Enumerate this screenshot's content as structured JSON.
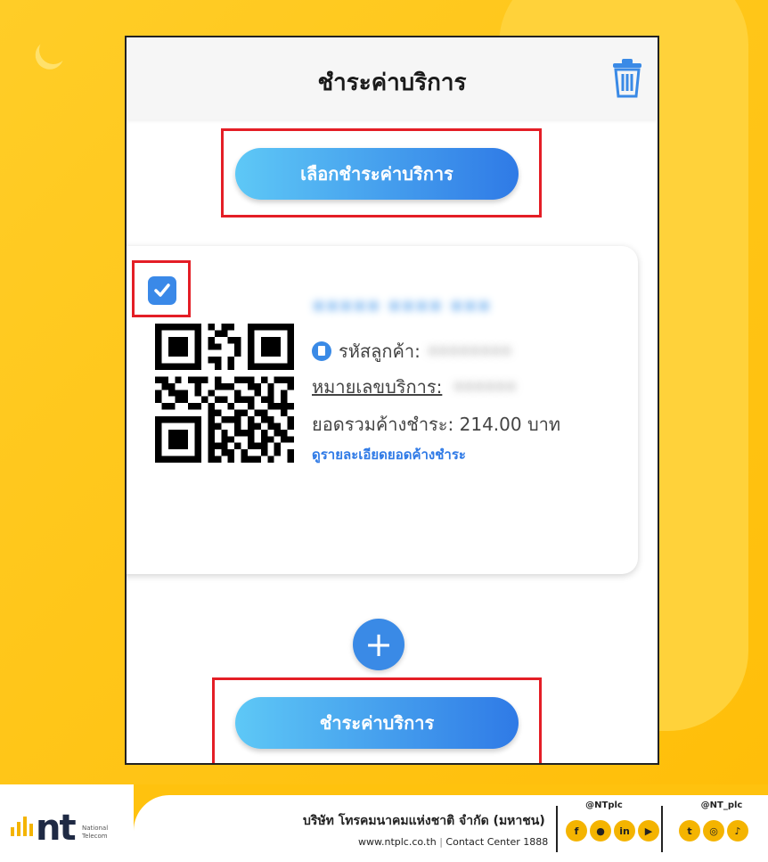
{
  "header": {
    "title": "ชำระค่าบริการ"
  },
  "select_button": {
    "label": "เลือกชำระค่าบริการ"
  },
  "bill": {
    "customer_name": "••••• •••• •••",
    "customer_code_label": "รหัสลูกค้า:",
    "customer_code_value": "••••••••",
    "service_number_label": "หมายเลขบริการ:",
    "service_number_value": "••••••",
    "total_due": "ยอดรวมค้างชำระ: 214.00 บาท",
    "details_link": "ดูรายละเอียดยอดค้างชำระ"
  },
  "pay_button": {
    "label": "ชำระค่าบริการ"
  },
  "footer": {
    "company": "บริษัท โทรคมนาคมแห่งชาติ จำกัด (มหาชน)",
    "website": "www.ntplc.co.th",
    "contact": "Contact Center 1888",
    "handle1": "@NTplc",
    "handle2": "@NT_plc",
    "logo_text": "nt",
    "logo_sub1": "National",
    "logo_sub2": "Telecom"
  },
  "icons": [
    "trash-icon",
    "checkbox-icon",
    "qr-code",
    "customer-code-icon",
    "plus-icon",
    "facebook-icon",
    "messenger-icon",
    "linkedin-icon",
    "youtube-icon",
    "twitter-icon",
    "instagram-icon",
    "tiktok-icon"
  ],
  "colors": {
    "background": "#ffc20e",
    "primary_blue": "#2f7ae6",
    "highlight_red": "#e41e26"
  }
}
